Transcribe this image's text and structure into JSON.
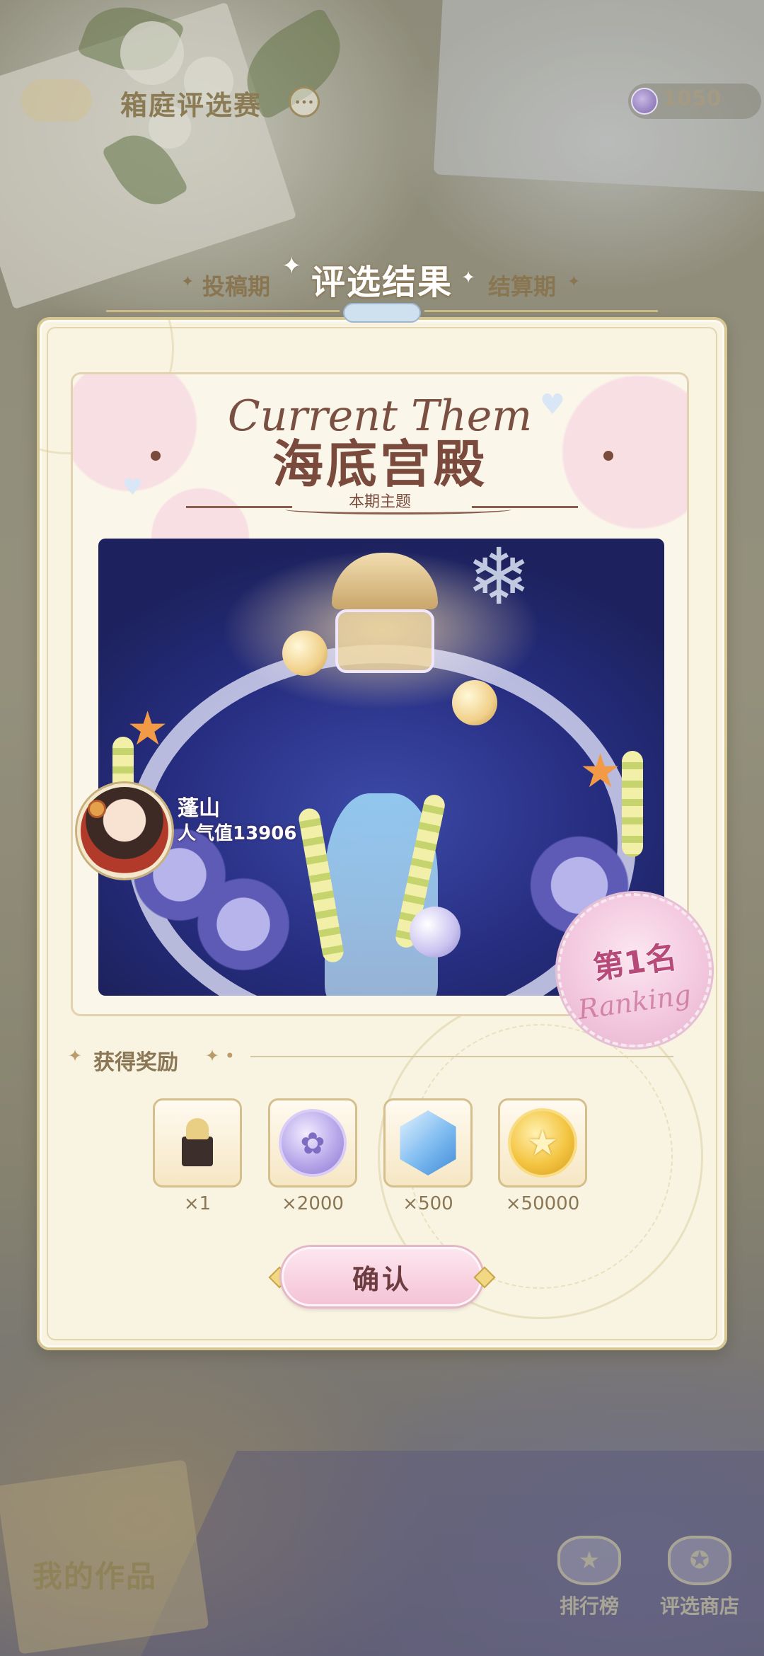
{
  "topbar": {
    "title": "箱庭评选赛",
    "currency_value": "1050",
    "currency_icon": "flower-coin-icon",
    "help_icon": "more-icon"
  },
  "phases": {
    "left": "投稿期",
    "right": "结算期"
  },
  "dialog": {
    "title": "评选结果",
    "theme": {
      "script": "Current Them",
      "name": "海底宫殿",
      "subtitle": "本期主题"
    },
    "creator": {
      "name": "蓬山",
      "popularity": "人气值13906"
    },
    "rank": {
      "label": "第1名",
      "script": "Ranking"
    },
    "rewards": {
      "title": "获得奖励",
      "items": [
        {
          "icon": "furniture-chest-icon",
          "qty": "×1"
        },
        {
          "icon": "purple-flower-coin-icon",
          "qty": "×2000"
        },
        {
          "icon": "blue-crystal-icon",
          "qty": "×500"
        },
        {
          "icon": "gold-star-coin-icon",
          "qty": "×50000"
        }
      ]
    },
    "confirm_label": "确认"
  },
  "bottom": {
    "my_works": "我的作品",
    "leaderboard": "排行榜",
    "shop": "评选商店"
  },
  "colors": {
    "panel_bg": "#f8f4e1",
    "panel_border": "#d7c795",
    "accent_pink": "#f4c3d6",
    "title_brown": "#7a4a3c",
    "artwork_blue": "#262d7f"
  }
}
